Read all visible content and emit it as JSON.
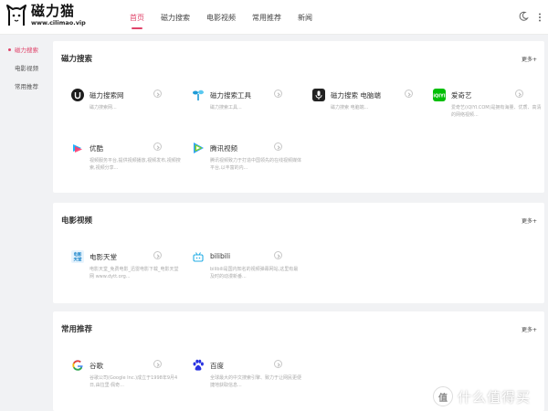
{
  "header": {
    "logo_title": "磁力猫",
    "logo_url": "www.cilimao.vip",
    "nav": [
      "首页",
      "磁力搜索",
      "电影视频",
      "常用推荐",
      "新闻"
    ]
  },
  "sidebar": {
    "items": [
      "磁力搜索",
      "电影视频",
      "常用推荐"
    ]
  },
  "sections": [
    {
      "title": "磁力搜索",
      "more": "更多+",
      "sites": [
        {
          "name": "磁力搜索网",
          "desc": "磁力搜索网..."
        },
        {
          "name": "磁力搜索工具",
          "desc": "磁力搜索工具..."
        },
        {
          "name": "磁力搜索 电脑端",
          "desc": "磁力搜索 电脑端..."
        },
        {
          "name": "爱奇艺",
          "desc": "爱奇艺(iQIYI.COM)是拥有海量、优质、高清的网络视频..."
        },
        {
          "name": "优酷",
          "desc": "视频服务平台,提供视频播放,视频发布,视频搜索,视频分享..."
        },
        {
          "name": "腾讯视频",
          "desc": "腾讯视频致力于打造中国领先的在线视频媒体平台,以丰富的内..."
        }
      ]
    },
    {
      "title": "电影视频",
      "more": "更多+",
      "sites": [
        {
          "name": "电影天堂",
          "desc": "电影天堂_免费电影_迅雷电影下载_电影天堂网 www.dytt.org..."
        },
        {
          "name": "bilibili",
          "desc": "bilibili是国内知名的视频弹幕网站,这里有最及时的动漫新番..."
        }
      ]
    },
    {
      "title": "常用推荐",
      "more": "更多+",
      "sites": [
        {
          "name": "谷歌",
          "desc": "谷歌公司(Google Inc.)成立于1998年9月4日,由拉里·佩奇..."
        },
        {
          "name": "百度",
          "desc": "全球最大的中文搜索引擎、致力于让网民更便捷地获取信息..."
        }
      ]
    }
  ],
  "watermark": {
    "badge": "值",
    "text": "什么值得买"
  },
  "colors": {
    "accent": "#e0446a",
    "background": "#f1f2f4"
  }
}
